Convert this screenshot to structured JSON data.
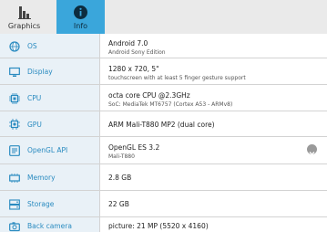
{
  "tabs": [
    {
      "label": "Graphics",
      "icon": "bar-chart-icon"
    },
    {
      "label": "Info",
      "icon": "info-icon"
    }
  ],
  "rows": [
    {
      "label": "OS",
      "icon": "globe-icon",
      "value": "Android 7.0",
      "sub": "Android Sony Edition"
    },
    {
      "label": "Display",
      "icon": "monitor-icon",
      "value": "1280 x 720, 5\"",
      "sub": "touchscreen with at least 5 finger gesture support"
    },
    {
      "label": "CPU",
      "icon": "cpu-chip-icon",
      "value": "octa core CPU @2.3GHz",
      "sub": "SoC: MediaTek MT6757 (Cortex A53 - ARMv8)"
    },
    {
      "label": "GPU",
      "icon": "gpu-chip-icon",
      "value": "ARM Mali-T880 MP2 (dual core)",
      "sub": ""
    },
    {
      "label": "OpenGL API",
      "icon": "opengl-icon",
      "value": "OpenGL ES 3.2",
      "sub": "Mali-T880",
      "expand_icon": "chevron-down-icon"
    },
    {
      "label": "Memory",
      "icon": "memory-icon",
      "value": "2.8 GB",
      "sub": ""
    },
    {
      "label": "Storage",
      "icon": "storage-icon",
      "value": "22 GB",
      "sub": ""
    },
    {
      "label": "Back camera",
      "icon": "camera-icon",
      "value": "picture: 21 MP (5520 x 4160)",
      "sub": ""
    }
  ],
  "colors": {
    "accent": "#3aa6db",
    "label_text": "#2a8bc0",
    "label_bg": "#e9f1f7",
    "tabbar_bg": "#eaeaea"
  }
}
